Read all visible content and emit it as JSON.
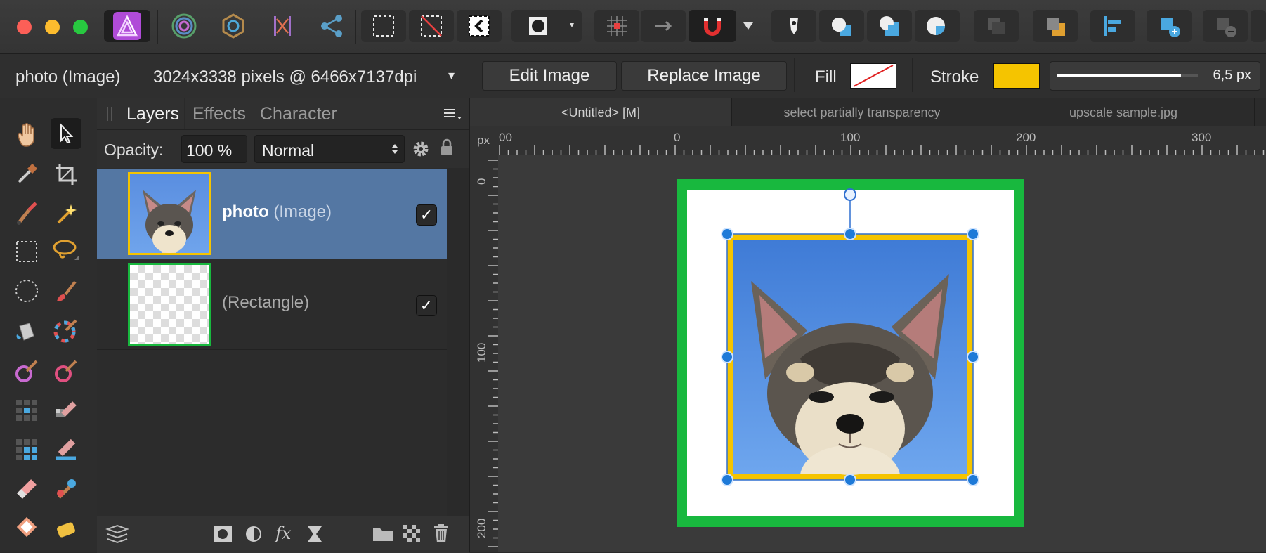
{
  "toolbar": {
    "icons": [
      "affinity-photo-logo",
      "persona-pixel-icon",
      "persona-export-icon",
      "persona-tone-icon",
      "share-icon",
      "marquee-icon",
      "deselect-icon",
      "invert-selection-icon",
      "mask-mode-icon",
      "dropdown-arrow-icon",
      "grid-snap-icon",
      "align-move-icon",
      "snapping-magnet-icon",
      "dropdown-arrow-icon",
      "stroke-pen-icon",
      "boolean-add-icon",
      "boolean-subtract-icon",
      "boolean-intersect-icon",
      "arrange-back-icon",
      "arrange-front-icon",
      "align-left-icon",
      "insert-layer-icon",
      "remove-layer-icon"
    ],
    "colors": {
      "accent": "#5477a3",
      "stroke": "#f5c400",
      "green": "#18b83e"
    }
  },
  "context": {
    "layer_name": "photo (Image)",
    "pixel_info": "3024x3338 pixels @ 6466x7137dpi",
    "dropdown_arrow": "▾",
    "edit_image_label": "Edit Image",
    "replace_image_label": "Replace Image",
    "fill_label": "Fill",
    "stroke_label": "Stroke",
    "stroke_width": "6,5 px",
    "stroke_color": "#f5c400",
    "stroke_width_fraction": 0.88
  },
  "layers_panel": {
    "tabs": [
      "Layers",
      "Effects",
      "Character"
    ],
    "opacity_label": "Opacity:",
    "opacity_value": "100 %",
    "blend_mode": "Normal",
    "layers": [
      {
        "name": "photo",
        "type": "(Image)",
        "visible": true,
        "selected": true
      },
      {
        "name": "",
        "type": "(Rectangle)",
        "visible": true,
        "selected": false
      }
    ]
  },
  "document": {
    "tabs": [
      "<Untitled> [M]",
      "select partially transparency",
      "upscale sample.jpg"
    ],
    "ruler_unit": "px",
    "ruler_h_labels": [
      "00",
      "0",
      "100",
      "200",
      "300"
    ],
    "ruler_v_labels": [
      "0",
      "100",
      "200"
    ]
  }
}
